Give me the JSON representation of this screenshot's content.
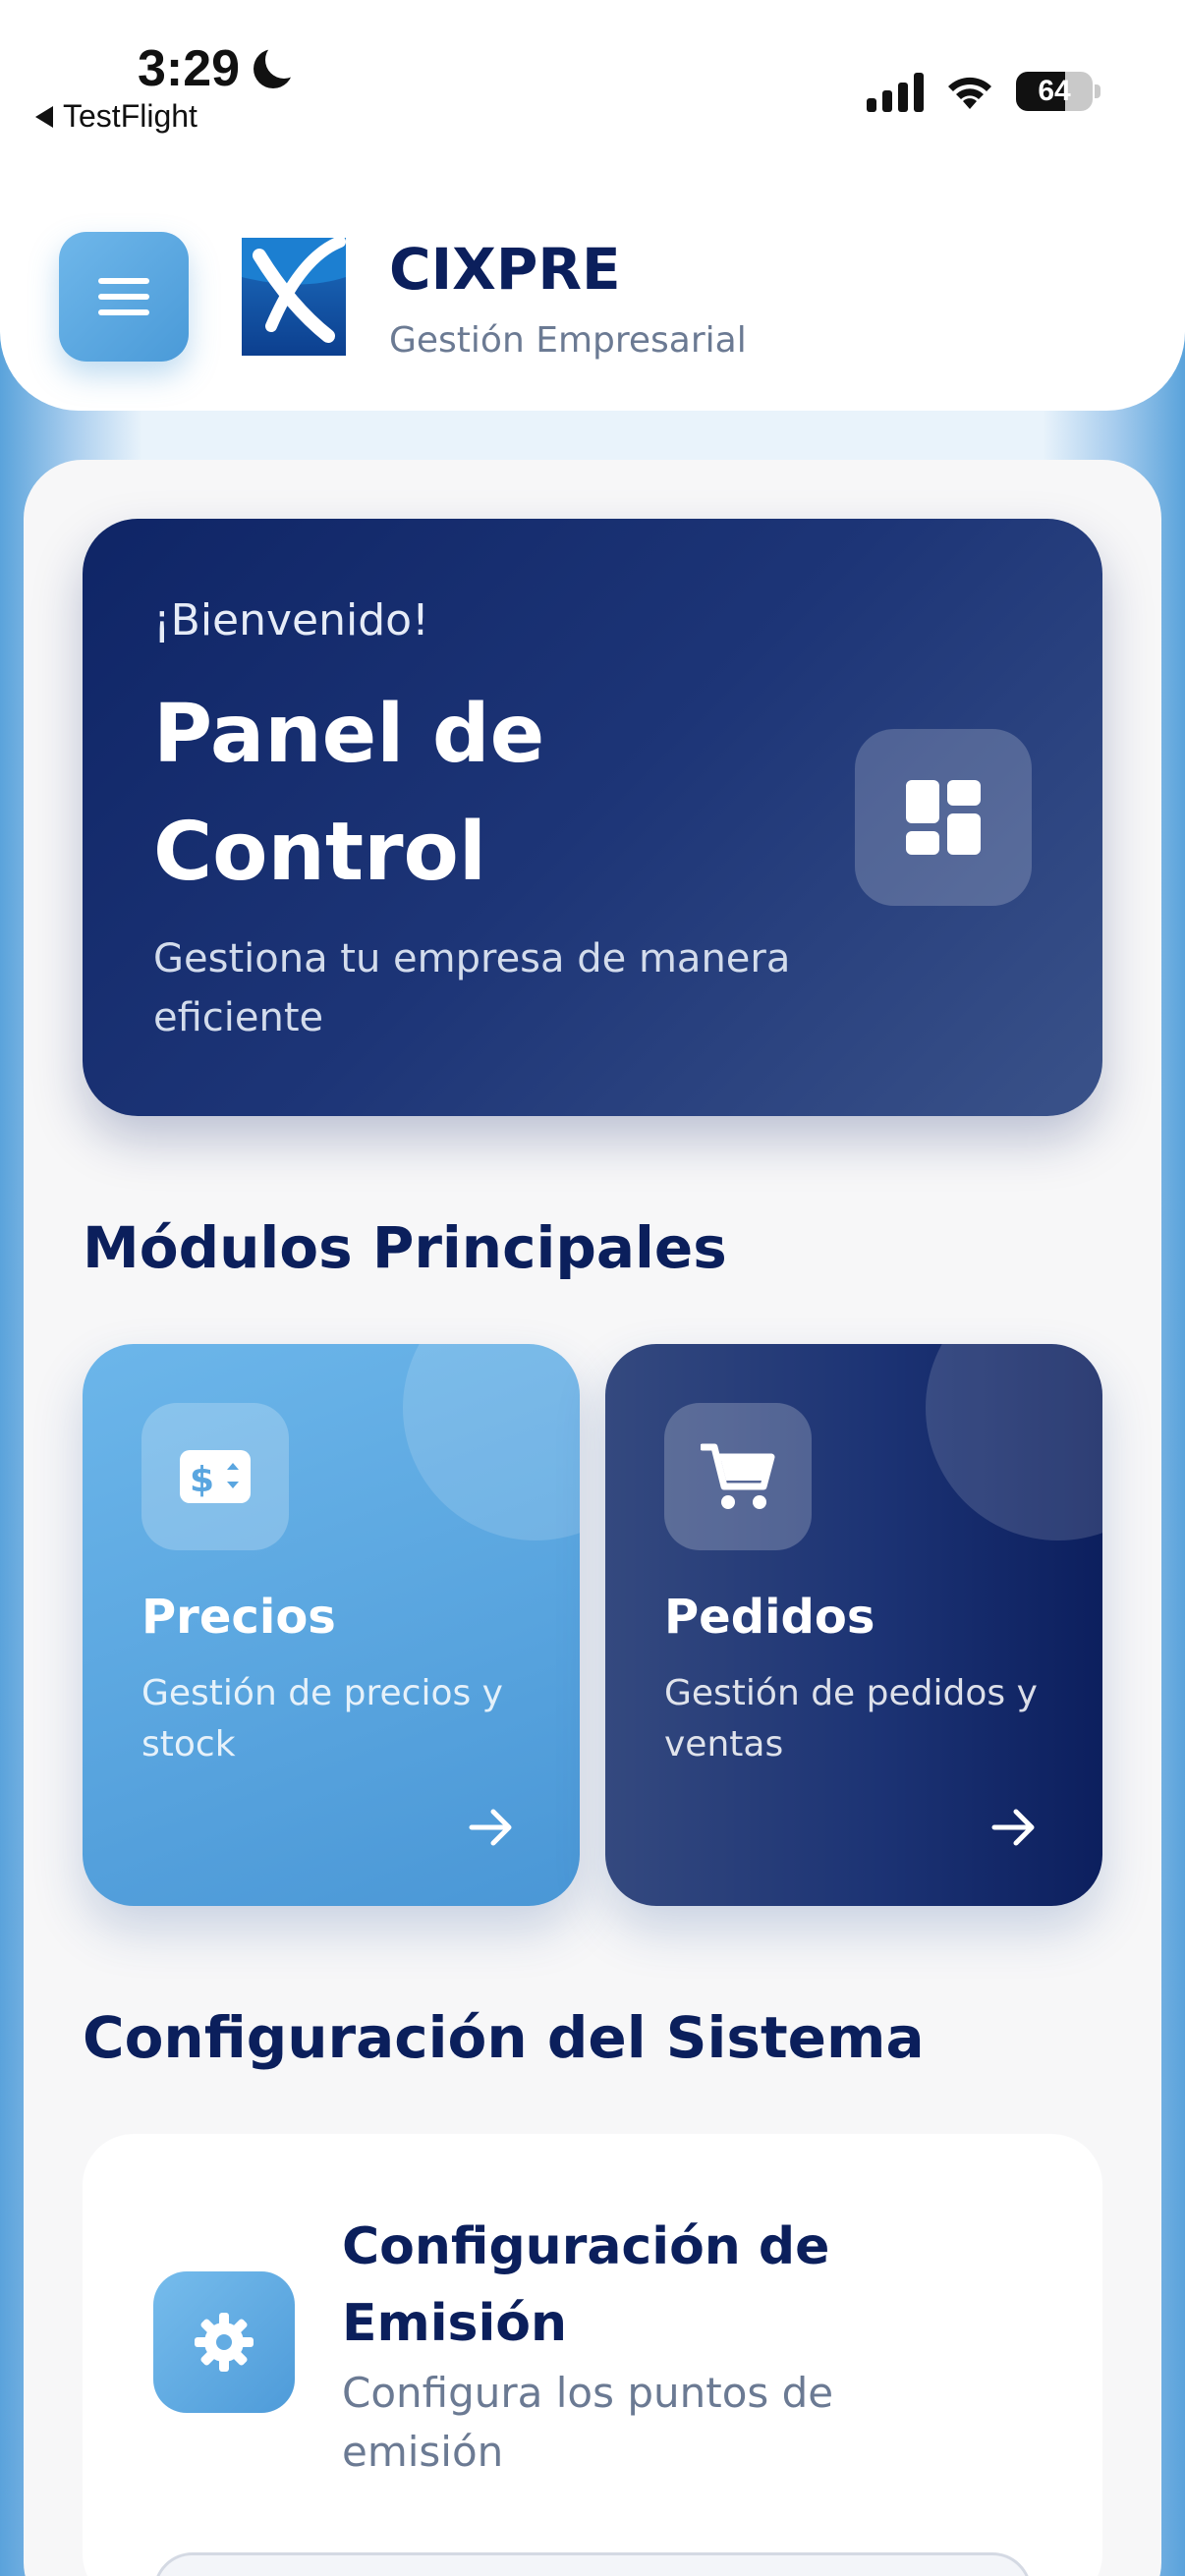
{
  "status_bar": {
    "time": "3:29",
    "back_app": "TestFlight",
    "battery": "64",
    "battery_level": 0.64
  },
  "header": {
    "brand_name": "CIXPRE",
    "brand_subtitle": "Gestión Empresarial",
    "menu_icon": "hamburger-icon",
    "logo_icon": "cixpre-logo"
  },
  "hero": {
    "greeting": "¡Bienvenido!",
    "title": "Panel de Control",
    "description": "Gestiona tu empresa de manera eficiente",
    "icon": "dashboard-icon"
  },
  "modules_section": {
    "title": "Módulos Principales",
    "items": [
      {
        "title": "Precios",
        "description": "Gestión de precios y stock",
        "icon": "price-tag-icon",
        "color": "#5aa6e0"
      },
      {
        "title": "Pedidos",
        "description": "Gestión de pedidos y ventas",
        "icon": "cart-icon",
        "color": "#1c3374"
      }
    ]
  },
  "config_section": {
    "title": "Configuración del Sistema",
    "items": [
      {
        "title": "Configuración de Emisión",
        "description": "Configura los puntos de emisión",
        "icon": "gear-icon"
      }
    ]
  },
  "colors": {
    "primary_dark": "#0b1f5c",
    "accent_blue": "#4a9ad8",
    "muted_text": "#6b7a93"
  }
}
